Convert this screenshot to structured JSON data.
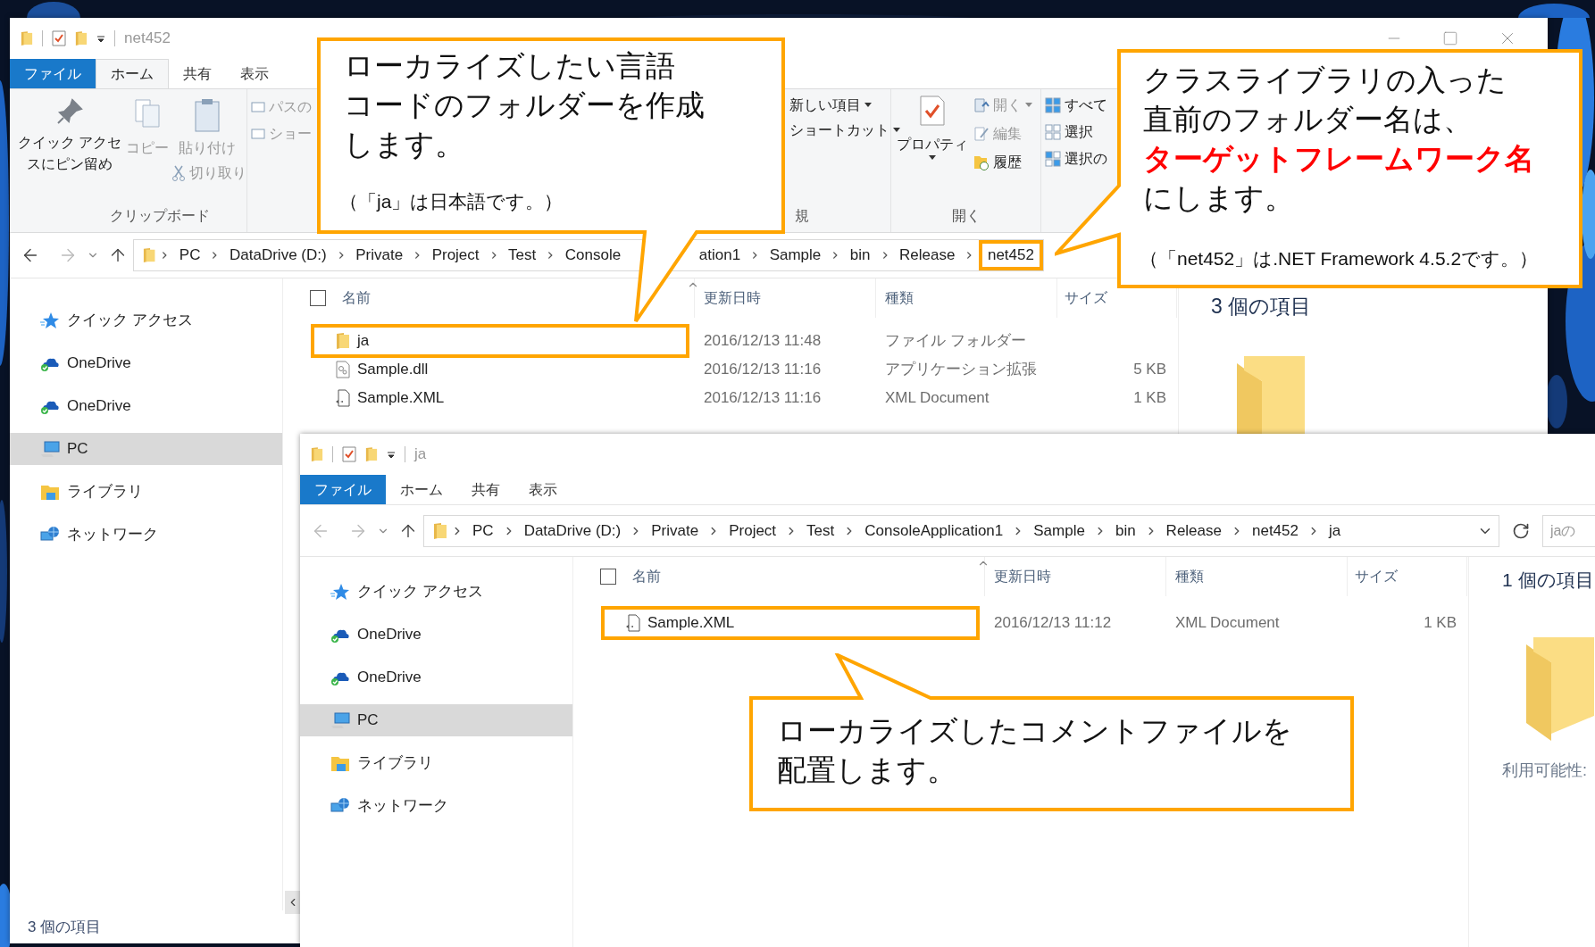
{
  "windows": [
    {
      "title": "net452",
      "tabs": [
        {
          "label": "ファイル",
          "kind": "file",
          "selected": false
        },
        {
          "label": "ホーム",
          "kind": "tab",
          "selected": true
        },
        {
          "label": "共有",
          "kind": "tab",
          "selected": false
        },
        {
          "label": "表示",
          "kind": "tab",
          "selected": false
        }
      ],
      "ribbon": {
        "clipboard": {
          "pin": {
            "label": "クイック アクセスにピン留め",
            "disabled": false
          },
          "copy": {
            "label": "コピー",
            "disabled": true
          },
          "paste": {
            "label": "貼り付け",
            "disabled": true
          },
          "cut": {
            "label": "切り取り",
            "disabled": true
          },
          "group_label": "クリップボード"
        },
        "organize": [
          {
            "label": "パスの",
            "disabled": true
          },
          {
            "label": "ショー",
            "disabled": true
          }
        ],
        "new": {
          "items": [
            {
              "label": "新しい項目"
            },
            {
              "label": "ショートカット"
            }
          ],
          "group_label": "規"
        },
        "open": {
          "properties": {
            "label": "プロパティ"
          },
          "items": [
            {
              "label": "開く",
              "kind": "open",
              "disabled": true
            },
            {
              "label": "編集",
              "kind": "edit",
              "disabled": true
            },
            {
              "label": "履歴",
              "kind": "history",
              "disabled": false
            }
          ],
          "group_label": "開く"
        },
        "select": [
          {
            "label": "すべて",
            "kind": "all"
          },
          {
            "label": "選択",
            "kind": "none"
          },
          {
            "label": "選択の",
            "kind": "invert"
          }
        ]
      },
      "crumbs": [
        {
          "label": "PC",
          "chevron": true,
          "highlighted": false
        },
        {
          "label": "DataDrive (D:)",
          "chevron": true,
          "highlighted": false
        },
        {
          "label": "Private",
          "chevron": true,
          "highlighted": false
        },
        {
          "label": "Project",
          "chevron": true,
          "highlighted": false
        },
        {
          "label": "Test",
          "chevron": true,
          "highlighted": false
        },
        {
          "label": "Console",
          "chevron": true,
          "highlighted": false
        },
        {
          "label": "ation1",
          "chevron": false,
          "highlighted": false
        },
        {
          "label": "Sample",
          "chevron": true,
          "highlighted": false
        },
        {
          "label": "bin",
          "chevron": true,
          "highlighted": false
        },
        {
          "label": "Release",
          "chevron": true,
          "highlighted": false
        },
        {
          "label": "net452",
          "chevron": true,
          "highlighted": true
        }
      ],
      "sidebar": [
        {
          "label": "クイック アクセス",
          "kind": "quick",
          "selected": false
        },
        {
          "label": "OneDrive",
          "kind": "cloud",
          "selected": false
        },
        {
          "label": "OneDrive",
          "kind": "cloud",
          "selected": false
        },
        {
          "label": "PC",
          "kind": "pc",
          "selected": true
        },
        {
          "label": "ライブラリ",
          "kind": "library",
          "selected": false
        },
        {
          "label": "ネットワーク",
          "kind": "network",
          "selected": false
        }
      ],
      "header_checkbox": {
        "checked": false
      },
      "columns": [
        "名前",
        "更新日時",
        "種類",
        "サイズ"
      ],
      "rows": [
        {
          "name": "ja",
          "date": "2016/12/13 11:48",
          "type": "ファイル フォルダー",
          "kind": "folder",
          "highlighted": true
        },
        {
          "name": "Sample.dll",
          "date": "2016/12/13 11:16",
          "type": "アプリケーション拡張",
          "size": "5 KB",
          "kind": "dll",
          "highlighted": false
        },
        {
          "name": "Sample.XML",
          "date": "2016/12/13 11:16",
          "type": "XML Document",
          "size": "1 KB",
          "kind": "xml",
          "highlighted": false
        }
      ],
      "details": {
        "count": "3 個の項目"
      },
      "status": "3 個の項目"
    },
    {
      "title": "ja",
      "tabs": [
        {
          "label": "ファイル",
          "kind": "file",
          "selected": false
        },
        {
          "label": "ホーム",
          "kind": "tab",
          "selected": false
        },
        {
          "label": "共有",
          "kind": "tab",
          "selected": false
        },
        {
          "label": "表示",
          "kind": "tab",
          "selected": false
        }
      ],
      "crumbs": [
        {
          "label": "PC",
          "chevron": true,
          "highlighted": false
        },
        {
          "label": "DataDrive (D:)",
          "chevron": true,
          "highlighted": false
        },
        {
          "label": "Private",
          "chevron": true,
          "highlighted": false
        },
        {
          "label": "Project",
          "chevron": true,
          "highlighted": false
        },
        {
          "label": "Test",
          "chevron": true,
          "highlighted": false
        },
        {
          "label": "ConsoleApplication1",
          "chevron": true,
          "highlighted": false
        },
        {
          "label": "Sample",
          "chevron": true,
          "highlighted": false
        },
        {
          "label": "bin",
          "chevron": true,
          "highlighted": false
        },
        {
          "label": "Release",
          "chevron": true,
          "highlighted": false
        },
        {
          "label": "net452",
          "chevron": true,
          "highlighted": false
        },
        {
          "label": "ja",
          "chevron": true,
          "highlighted": false
        }
      ],
      "search": {
        "placeholder": "jaの"
      },
      "sidebar": [
        {
          "label": "クイック アクセス",
          "kind": "quick",
          "selected": false
        },
        {
          "label": "OneDrive",
          "kind": "cloud",
          "selected": false
        },
        {
          "label": "OneDrive",
          "kind": "cloud",
          "selected": false
        },
        {
          "label": "PC",
          "kind": "pc",
          "selected": true
        },
        {
          "label": "ライブラリ",
          "kind": "library",
          "selected": false
        },
        {
          "label": "ネットワーク",
          "kind": "network",
          "selected": false
        }
      ],
      "header_checkbox": {
        "checked": false
      },
      "columns": [
        "名前",
        "更新日時",
        "種類",
        "サイズ"
      ],
      "rows": [
        {
          "name": "Sample.XML",
          "date": "2016/12/13 11:12",
          "type": "XML Document",
          "size": "1 KB",
          "kind": "xml",
          "highlighted": true
        }
      ],
      "details": {
        "count": "1 個の項目",
        "availability": "利用可能性:"
      }
    }
  ],
  "callouts": [
    {
      "lines": [
        "ローカライズしたい言語",
        "コードのフォルダーを作成",
        "します。"
      ],
      "note": "（「ja」は日本語です。）"
    },
    {
      "lines": [
        "クラスライブラリの入った",
        "直前のフォルダー名は、",
        "**ターゲットフレームワーク名**",
        "にします。"
      ],
      "note": "（「net452」は.NET Framework 4.5.2です。）"
    },
    {
      "lines": [
        "ローカライズしたコメントファイルを",
        "配置します。"
      ]
    }
  ]
}
